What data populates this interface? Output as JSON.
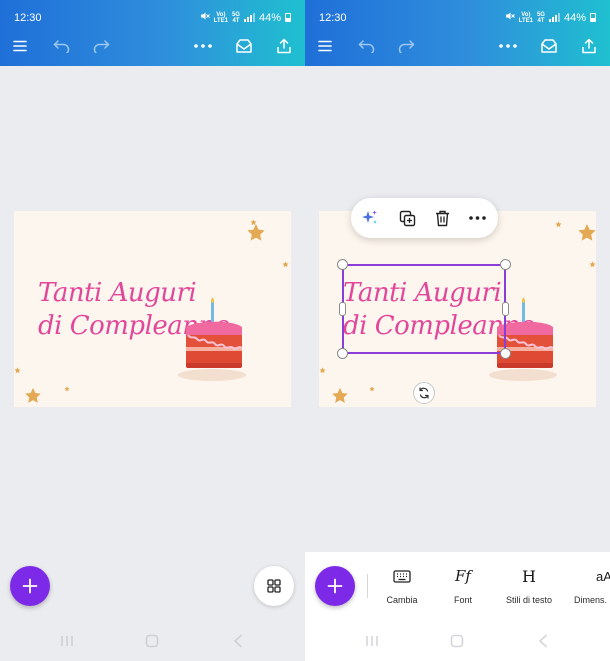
{
  "status_bar": {
    "time": "12:30",
    "network_top": "Vo)",
    "network_mid": "LTE1",
    "network_5g": "5G",
    "network_sub": "4T",
    "battery_percent": "44%"
  },
  "toolbar": {
    "icons": [
      "menu-icon",
      "undo-icon",
      "redo-icon",
      "more-icon",
      "inbox-icon",
      "share-icon"
    ]
  },
  "design": {
    "text_line1": "Tanti Auguri",
    "text_line2": "di Compleanno",
    "text_color": "#e2479a",
    "background_color": "#fdf6ee"
  },
  "context_menu": {
    "icons": [
      "magic-sparkle-icon",
      "duplicate-icon",
      "trash-icon",
      "more-icon"
    ]
  },
  "bottom_toolbar": {
    "items": [
      {
        "label": "Cambia",
        "icon": "keyboard-icon"
      },
      {
        "label": "Font",
        "icon": "font-icon",
        "glyph": "Ff"
      },
      {
        "label": "Stili di testo",
        "icon": "text-style-icon",
        "glyph": "H"
      },
      {
        "label": "Dimens.",
        "icon": "text-size-icon",
        "glyph": "aA"
      }
    ]
  },
  "colors": {
    "accent": "#7d2ae8",
    "selection": "#8b3dd8",
    "header_gradient_start": "#1f6fd8",
    "header_gradient_end": "#1fc0d0"
  }
}
